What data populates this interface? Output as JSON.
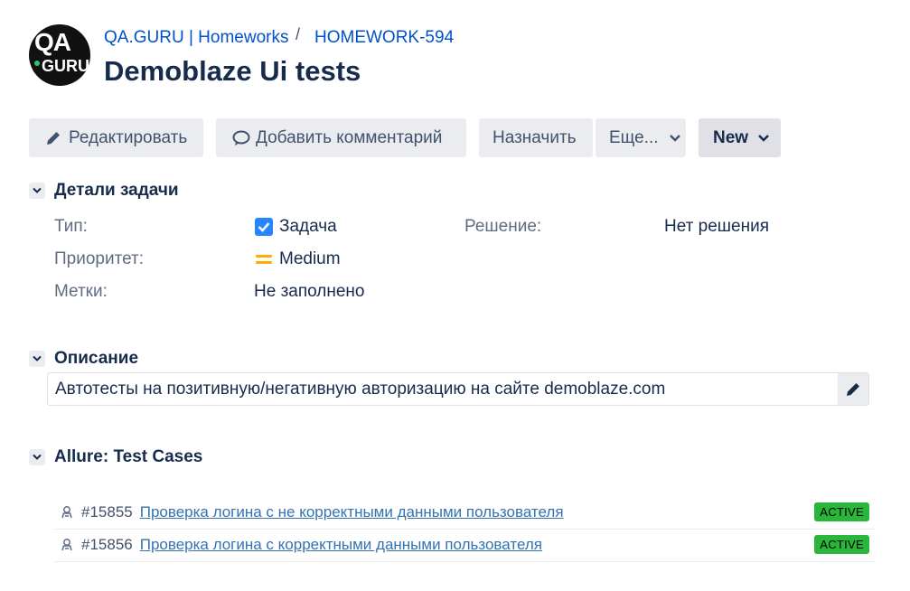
{
  "header": {
    "logo_text_top": "QA",
    "logo_text_bottom": "GURU",
    "breadcrumb_project": "QA.GURU | Homeworks",
    "breadcrumb_separator": "/",
    "breadcrumb_issue": "HOMEWORK-594",
    "title": "Demoblaze Ui tests"
  },
  "toolbar": {
    "edit_label": "Редактировать",
    "comment_label": "Добавить комментарий",
    "assign_label": "Назначить",
    "more_label": "Еще...",
    "status_label": "New"
  },
  "details": {
    "section_title": "Детали задачи",
    "type_label": "Тип:",
    "type_value": "Задача",
    "resolution_label": "Решение:",
    "resolution_value": "Нет решения",
    "priority_label": "Приоритет:",
    "priority_value": "Medium",
    "labels_label": "Метки:",
    "labels_value": "Не заполнено"
  },
  "description": {
    "section_title": "Описание",
    "text": "Автотесты на позитивную/негативную авторизацию на сайте demoblaze.com"
  },
  "allure": {
    "section_title": "Allure: Test Cases",
    "cases": [
      {
        "id": "#15855",
        "title": "Проверка логина с не корректными данными пользователя",
        "status": "ACTIVE"
      },
      {
        "id": "#15856",
        "title": "Проверка логина с корректными данными пользователя",
        "status": "ACTIVE"
      }
    ]
  },
  "colors": {
    "link": "#0052cc",
    "type_checkbox": "#2684ff",
    "priority_medium": "#ffab00",
    "active_badge": "#2ab63a"
  }
}
